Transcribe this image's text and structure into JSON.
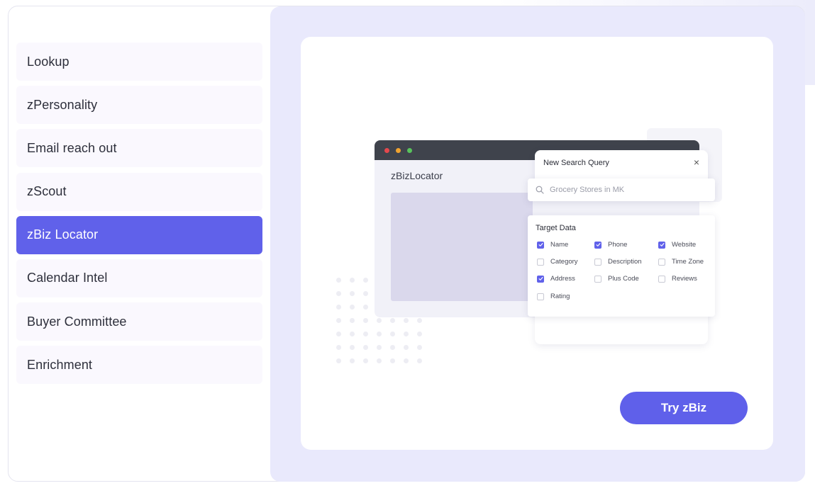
{
  "sidebar": {
    "items": [
      {
        "label": "Lookup"
      },
      {
        "label": "zPersonality"
      },
      {
        "label": "Email reach out"
      },
      {
        "label": "zScout"
      },
      {
        "label": "zBiz Locator",
        "active": true
      },
      {
        "label": "Calendar Intel"
      },
      {
        "label": "Buyer Committee"
      },
      {
        "label": "Enrichment"
      }
    ]
  },
  "illustration": {
    "browser_title": "zBizLocator",
    "modal_title": "New Search Query",
    "close_glyph": "×",
    "search_query": "Grocery Stores in MK",
    "target_title": "Target Data",
    "options": [
      {
        "label": "Name",
        "checked": true
      },
      {
        "label": "Phone",
        "checked": true
      },
      {
        "label": "Website",
        "checked": true
      },
      {
        "label": "Category",
        "checked": false
      },
      {
        "label": "Description",
        "checked": false
      },
      {
        "label": "Time Zone",
        "checked": false
      },
      {
        "label": "Address",
        "checked": true
      },
      {
        "label": "Plus Code",
        "checked": false
      },
      {
        "label": "Reviews",
        "checked": false
      },
      {
        "label": "Rating",
        "checked": false
      }
    ]
  },
  "cta": {
    "label": "Try zBiz"
  },
  "colors": {
    "accent": "#6061ea",
    "panel_bg": "#e9e9fc",
    "nav_bg": "#faf8fe"
  }
}
